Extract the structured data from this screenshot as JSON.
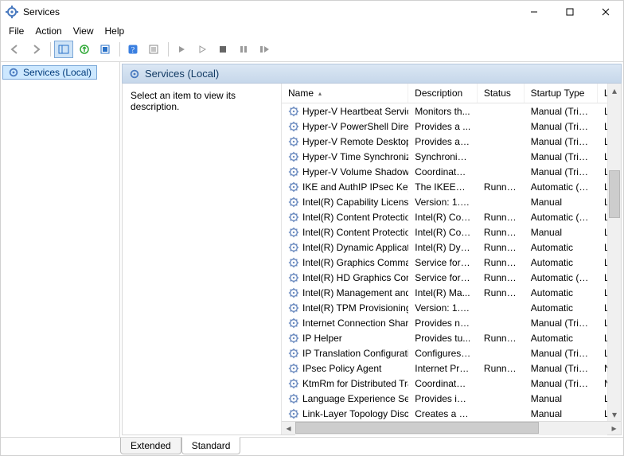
{
  "window": {
    "title": "Services"
  },
  "menu": {
    "file": "File",
    "action": "Action",
    "view": "View",
    "help": "Help"
  },
  "tree": {
    "root": "Services (Local)"
  },
  "pane": {
    "header": "Services (Local)",
    "desc_prompt": "Select an item to view its description."
  },
  "columns": {
    "name": "Name",
    "description": "Description",
    "status": "Status",
    "startup": "Startup Type",
    "logon": "Log"
  },
  "tabs": {
    "extended": "Extended",
    "standard": "Standard"
  },
  "services": [
    {
      "name": "Hyper-V Heartbeat Service",
      "desc": "Monitors th...",
      "status": "",
      "startup": "Manual (Trig...",
      "logon": "Loca"
    },
    {
      "name": "Hyper-V PowerShell Direct ...",
      "desc": "Provides a ...",
      "status": "",
      "startup": "Manual (Trig...",
      "logon": "Loca"
    },
    {
      "name": "Hyper-V Remote Desktop Vi...",
      "desc": "Provides a p...",
      "status": "",
      "startup": "Manual (Trig...",
      "logon": "Loca"
    },
    {
      "name": "Hyper-V Time Synchronizati...",
      "desc": "Synchronize...",
      "status": "",
      "startup": "Manual (Trig...",
      "logon": "Loca"
    },
    {
      "name": "Hyper-V Volume Shadow C...",
      "desc": "Coordinates...",
      "status": "",
      "startup": "Manual (Trig...",
      "logon": "Loca"
    },
    {
      "name": "IKE and AuthIP IPsec Keying...",
      "desc": "The IKEEXT ...",
      "status": "Running",
      "startup": "Automatic (T...",
      "logon": "Loca"
    },
    {
      "name": "Intel(R) Capability Licensing...",
      "desc": "Version: 1.6...",
      "status": "",
      "startup": "Manual",
      "logon": "Loca"
    },
    {
      "name": "Intel(R) Content Protection ...",
      "desc": "Intel(R) Con...",
      "status": "Running",
      "startup": "Automatic (T...",
      "logon": "Loca"
    },
    {
      "name": "Intel(R) Content Protection ...",
      "desc": "Intel(R) Con...",
      "status": "Running",
      "startup": "Manual",
      "logon": "Loca"
    },
    {
      "name": "Intel(R) Dynamic Applicatio...",
      "desc": "Intel(R) Dyn...",
      "status": "Running",
      "startup": "Automatic",
      "logon": "Loca"
    },
    {
      "name": "Intel(R) Graphics Command...",
      "desc": "Service for I...",
      "status": "Running",
      "startup": "Automatic",
      "logon": "Loca"
    },
    {
      "name": "Intel(R) HD Graphics Contro...",
      "desc": "Service for I...",
      "status": "Running",
      "startup": "Automatic (T...",
      "logon": "Loca"
    },
    {
      "name": "Intel(R) Management and S...",
      "desc": "Intel(R) Ma...",
      "status": "Running",
      "startup": "Automatic",
      "logon": "Loca"
    },
    {
      "name": "Intel(R) TPM Provisioning S...",
      "desc": "Version: 1.6...",
      "status": "",
      "startup": "Automatic",
      "logon": "Loca"
    },
    {
      "name": "Internet Connection Sharin...",
      "desc": "Provides ne...",
      "status": "",
      "startup": "Manual (Trig...",
      "logon": "Loca"
    },
    {
      "name": "IP Helper",
      "desc": "Provides tu...",
      "status": "Running",
      "startup": "Automatic",
      "logon": "Loca"
    },
    {
      "name": "IP Translation Configuration...",
      "desc": "Configures ...",
      "status": "",
      "startup": "Manual (Trig...",
      "logon": "Loca"
    },
    {
      "name": "IPsec Policy Agent",
      "desc": "Internet Pro...",
      "status": "Running",
      "startup": "Manual (Trig...",
      "logon": "Net"
    },
    {
      "name": "KtmRm for Distributed Tran...",
      "desc": "Coordinates...",
      "status": "",
      "startup": "Manual (Trig...",
      "logon": "Net"
    },
    {
      "name": "Language Experience Service",
      "desc": "Provides inf...",
      "status": "",
      "startup": "Manual",
      "logon": "Loca"
    },
    {
      "name": "Link-Layer Topology Discov...",
      "desc": "Creates a N...",
      "status": "",
      "startup": "Manual",
      "logon": "Loca"
    }
  ]
}
